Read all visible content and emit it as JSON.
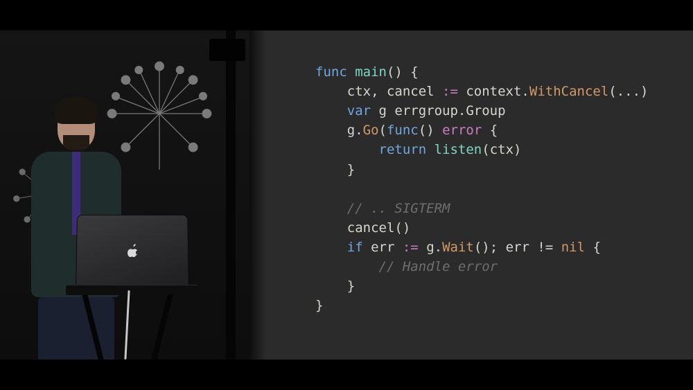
{
  "code": {
    "l1a": "func",
    "l1b": " ",
    "l1c": "main",
    "l1d": "() {",
    "l2a": "    ctx, cancel ",
    "l2b": ":=",
    "l2c": " context.",
    "l2d": "WithCancel",
    "l2e": "(...)",
    "l3a": "    ",
    "l3b": "var",
    "l3c": " g errgroup.Group",
    "l4a": "    g.",
    "l4b": "Go",
    "l4c": "(",
    "l4d": "func",
    "l4e": "() ",
    "l4f": "error",
    "l4g": " {",
    "l5a": "        ",
    "l5b": "return",
    "l5c": " ",
    "l5d": "listen",
    "l5e": "(ctx)",
    "l6": "    }",
    "blank1": "",
    "l7": "    // .. SIGTERM",
    "l8": "    cancel()",
    "l9a": "    ",
    "l9b": "if",
    "l9c": " err ",
    "l9d": ":=",
    "l9e": " g.",
    "l9f": "Wait",
    "l9g": "(); err != ",
    "l9h": "nil",
    "l9i": " {",
    "l10": "        // Handle error",
    "l11": "    }",
    "l12": "}"
  }
}
